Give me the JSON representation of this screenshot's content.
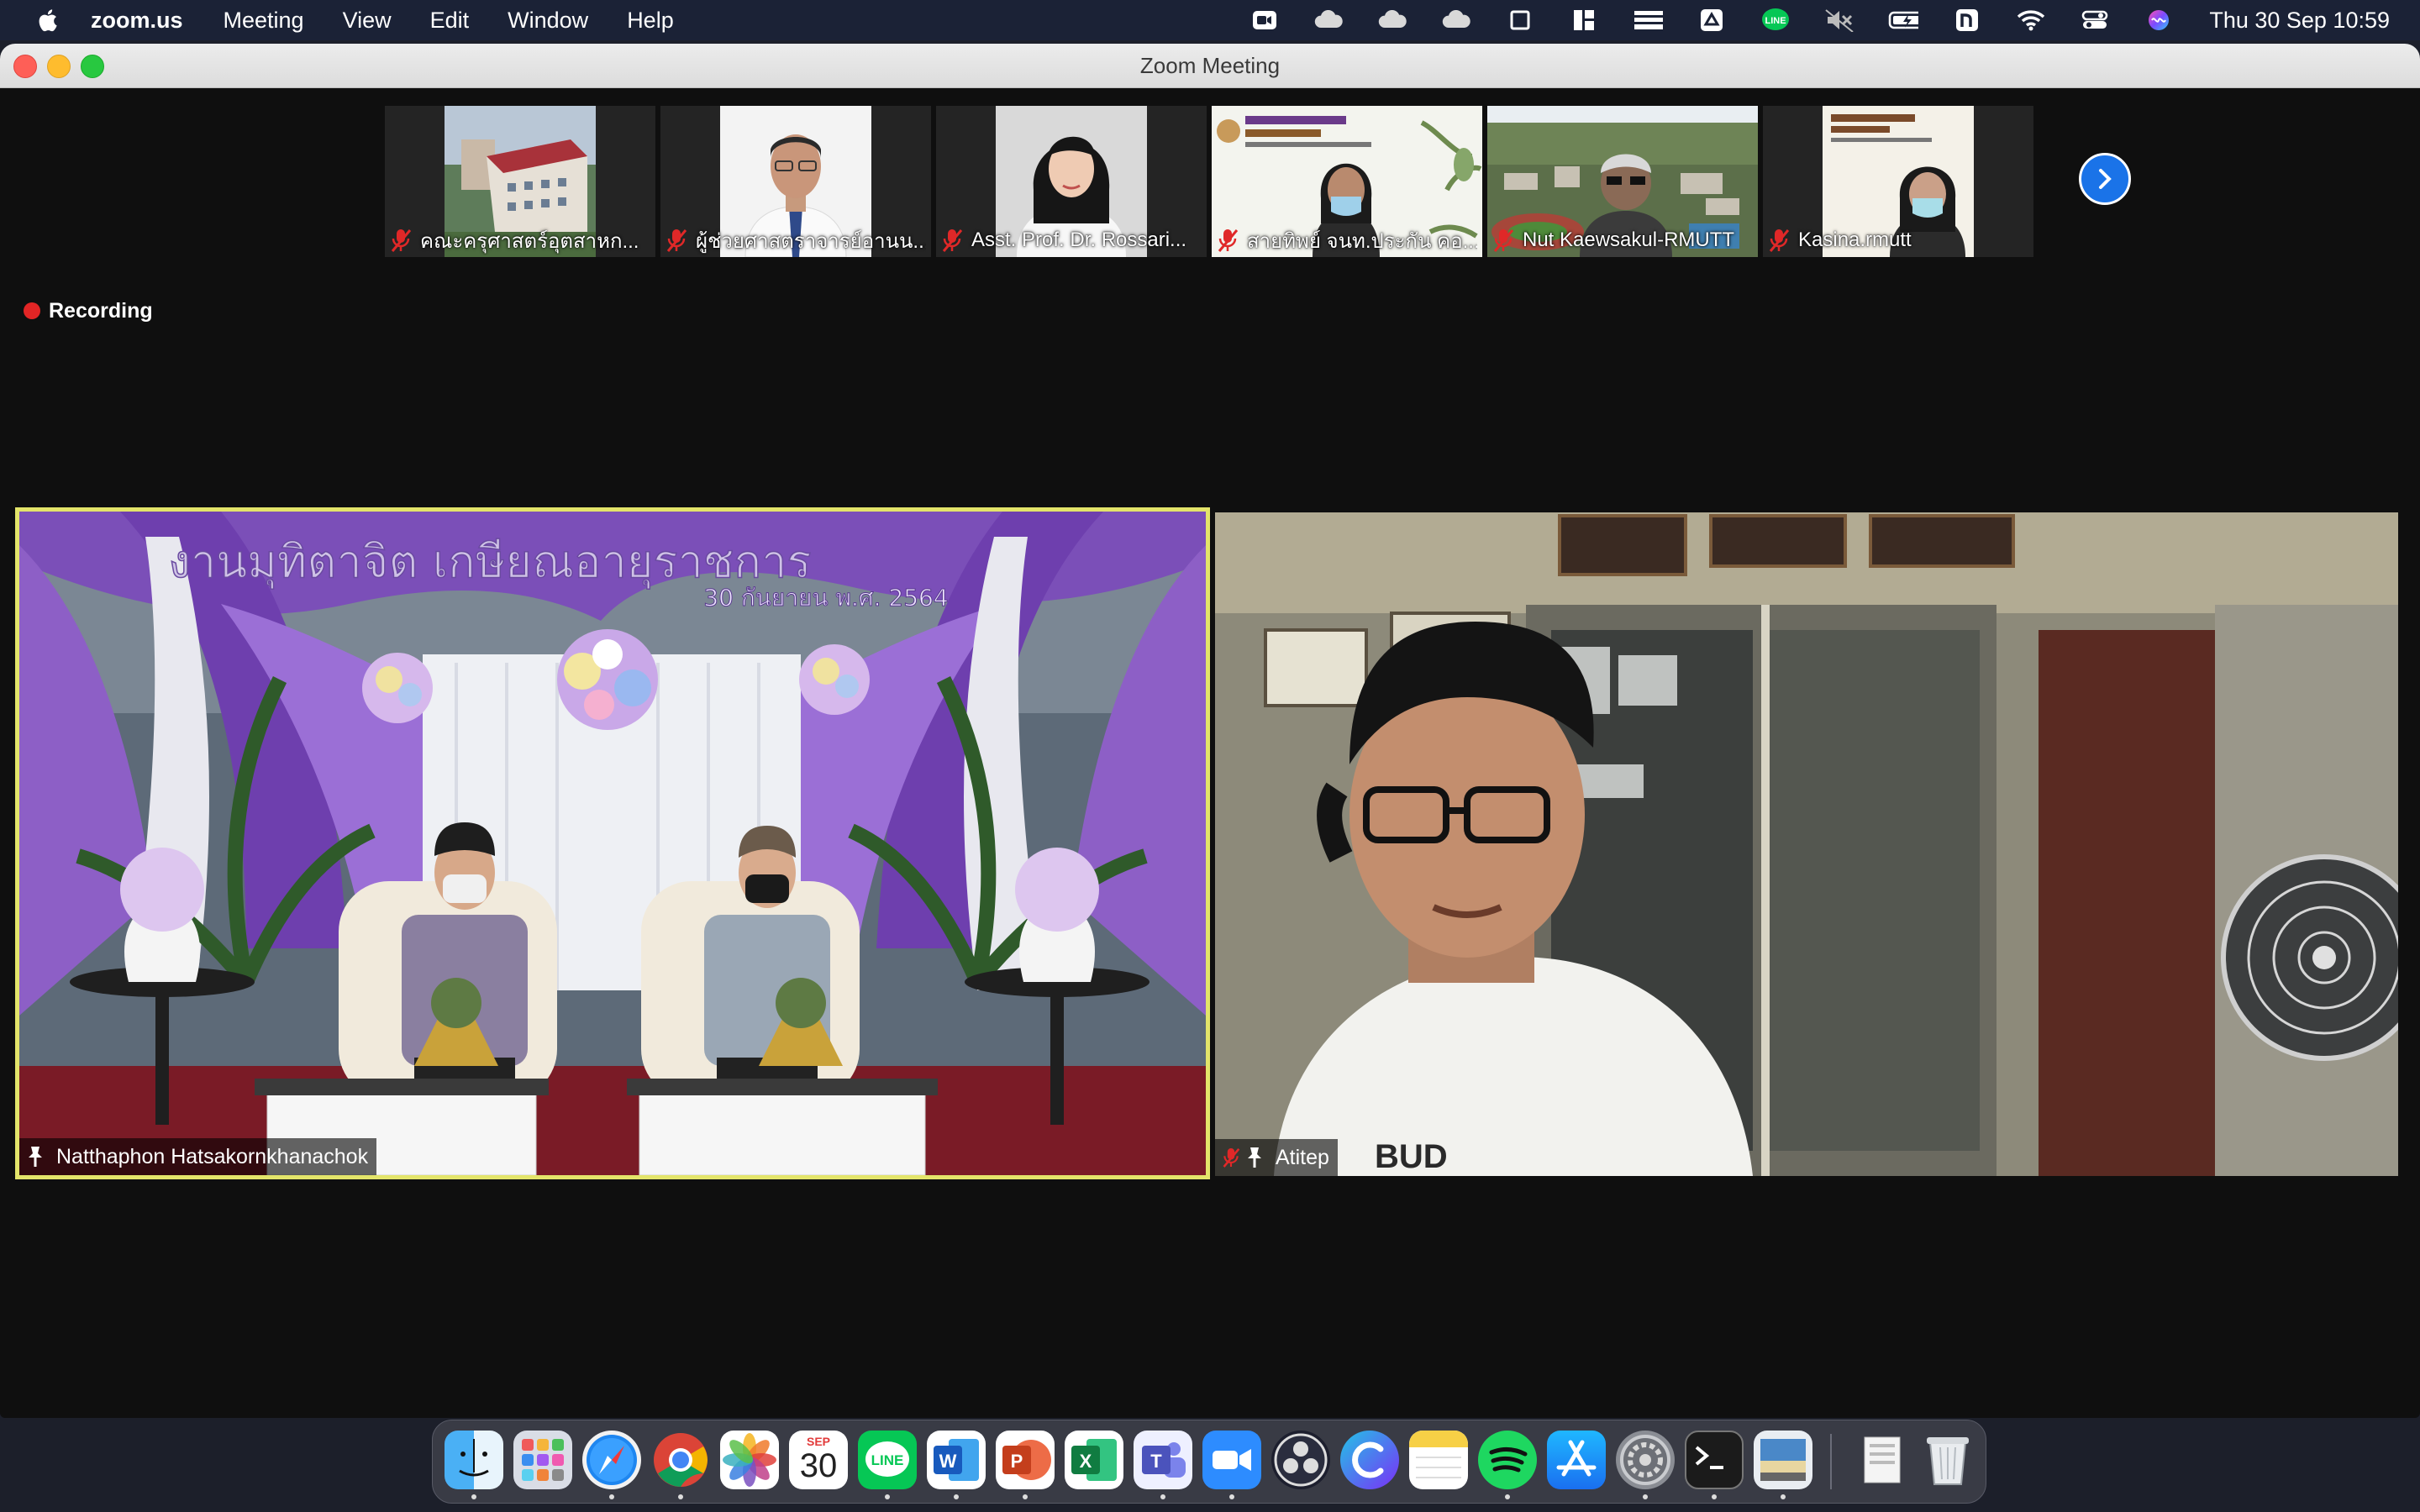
{
  "menubar": {
    "app_name": "zoom.us",
    "menus": [
      "Meeting",
      "View",
      "Edit",
      "Window",
      "Help"
    ],
    "status_icons": [
      "zoom-video-icon",
      "cloud-icon",
      "cloud-icon",
      "cloud-icon",
      "square-icon",
      "layout-icon",
      "bars-icon",
      "drive-icon",
      "line-icon",
      "mute-icon",
      "battery-icon",
      "n-icon",
      "wifi-icon",
      "control-center-icon",
      "siri-icon"
    ],
    "clock": "Thu 30 Sep  10:59"
  },
  "window": {
    "title": "Zoom Meeting"
  },
  "thumbnails": [
    {
      "name": "คณะครุศาสตร์อุตสาหก...",
      "muted": true
    },
    {
      "name": "ผู้ช่วยศาสตราจารย์อานน...",
      "muted": true
    },
    {
      "name": "Asst. Prof. Dr. Rossari...",
      "muted": true
    },
    {
      "name": "สายทิพย์ จนท.ประกัน คอ...",
      "muted": true
    },
    {
      "name": "Nut Kaewsakul-RMUTT",
      "muted": true
    },
    {
      "name": "Kasina.rmutt",
      "muted": true
    }
  ],
  "recording": {
    "label": "Recording"
  },
  "videos": [
    {
      "name": "Natthaphon Hatsakornkhanachok",
      "pinned": true,
      "muted": false,
      "active_speaker": true
    },
    {
      "name": "Atitep",
      "pinned": true,
      "muted": true
    }
  ],
  "scene": {
    "banner_text": "งานมุทิตาจิต เกษียณอายุราชการ",
    "date_text": "30 กันยายน พ.ศ. 2564"
  },
  "shirt_text": "BUD",
  "dock": {
    "apps": [
      "Finder",
      "Launchpad",
      "Safari",
      "Chrome",
      "Photos",
      "Calendar",
      "LINE",
      "Word",
      "PowerPoint",
      "Excel",
      "Teams",
      "Zoom",
      "OBS",
      "Canva",
      "Notes",
      "Spotify",
      "App Store",
      "System Preferences",
      "Terminal",
      "Preview"
    ],
    "calendar_month": "SEP",
    "calendar_day": "30",
    "line_label": "LINE"
  }
}
